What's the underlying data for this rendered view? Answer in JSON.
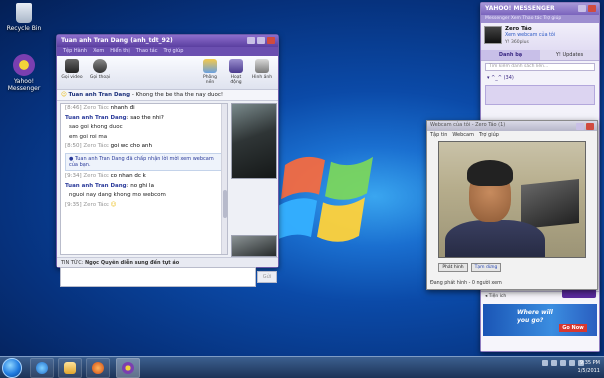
{
  "desktop": {
    "icons": [
      {
        "label": "Recycle Bin"
      },
      {
        "label": "Yahoo! Messenger"
      }
    ]
  },
  "chat_window": {
    "title": "Tuan anh Tran Dang (anh_tdt_92)",
    "menu": [
      "Tệp Hành",
      "Xem",
      "Hiển thị",
      "Thao tác",
      "Trợ giúp"
    ],
    "toolbar": [
      {
        "label": "Gọi video"
      },
      {
        "label": "Gọi thoại"
      },
      {
        "label": "Phông nền"
      },
      {
        "label": "Hoạt động"
      },
      {
        "label": "Hình ảnh"
      }
    ],
    "status_name": "Tuan anh Tran Dang",
    "status_text": "Khong the be tha the nay duoc!",
    "messages": [
      {
        "from": "Zero Táo",
        "ts": "[8:46]",
        "text": "nhanh đi"
      },
      {
        "from": "Tuan anh Tran Dang",
        "text": "sao the nhi?"
      },
      {
        "text": "sao goi khong duoc"
      },
      {
        "text": "em goi roi ma"
      },
      {
        "from": "Zero Táo",
        "ts": "[8:50]",
        "text": "goi wc cho anh"
      },
      {
        "notice": "Tuan anh Tran Dang đã chấp nhận lời mời xem webcam của bạn."
      },
      {
        "from": "Zero Táo",
        "ts": "[9:34]",
        "text": "co nhan dc k"
      },
      {
        "from": "Tuan anh Tran Dang",
        "text": "no ghi la"
      },
      {
        "text": "nguoi nay dang khong mo webcom"
      },
      {
        "from": "Zero Táo",
        "ts": "[9:35]",
        "text": "☺"
      }
    ],
    "send_label": "Gửi",
    "news_label": "TIN TỨC:",
    "news_text": "Ngọc Quyên diễn sung đến tụt áo"
  },
  "main_window": {
    "title": "YAHOO! MESSENGER",
    "menu": "Messenger  Xem  Thao tác  Trợ giúp",
    "profile_name": "Zero Táo",
    "profile_status": "Xem webcam của tôi",
    "profile_360": "Y! 360plus",
    "tabs": [
      "Danh bạ",
      "Y! Updates"
    ],
    "search_placeholder": "Tìm kiếm danh sách liên...",
    "group_label": "^_^ (34)",
    "footer_left": "Tiện ích",
    "footer_right": "Thêm tiện ích",
    "ad_line1": "Where will",
    "ad_line2": "you go?",
    "ad_go": "Go Now",
    "ad_logo": "YAHOO! TRAVEL"
  },
  "webcam_window": {
    "title": "Webcam của tôi - Zero Táo (1)",
    "menu": [
      "Tập tin",
      "Webcam",
      "Trợ giúp"
    ],
    "btn_broadcast": "Phát hình",
    "btn_stop": "Tạm dừng",
    "status": "Đang phát hình - 0 người xem"
  },
  "taskbar": {
    "time": "9:35 PM",
    "date": "1/5/2011"
  },
  "colors": {
    "yahoo_purple": "#6b4fb0",
    "desktop_blue": "#0b4aa8"
  }
}
